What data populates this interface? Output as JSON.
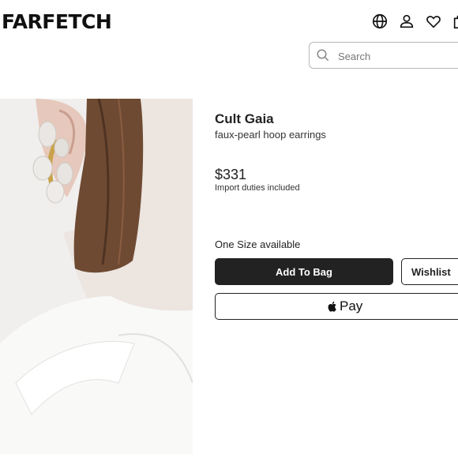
{
  "header": {
    "logo": "FARFETCH",
    "icons": [
      "globe-icon",
      "account-icon",
      "wishlist-heart-icon",
      "bag-icon"
    ]
  },
  "search": {
    "placeholder": "Search",
    "value": ""
  },
  "product": {
    "brand": "Cult Gaia",
    "name": "faux-pearl hoop earrings",
    "price": "$331",
    "duties_note": "Import duties included",
    "size_availability": "One Size available"
  },
  "actions": {
    "add_to_bag_label": "Add To Bag",
    "wishlist_label": "Wishlist",
    "apple_pay_label": "Pay"
  },
  "colors": {
    "primary_button": "#222222",
    "text": "#222222",
    "border": "#b9b9b9"
  }
}
